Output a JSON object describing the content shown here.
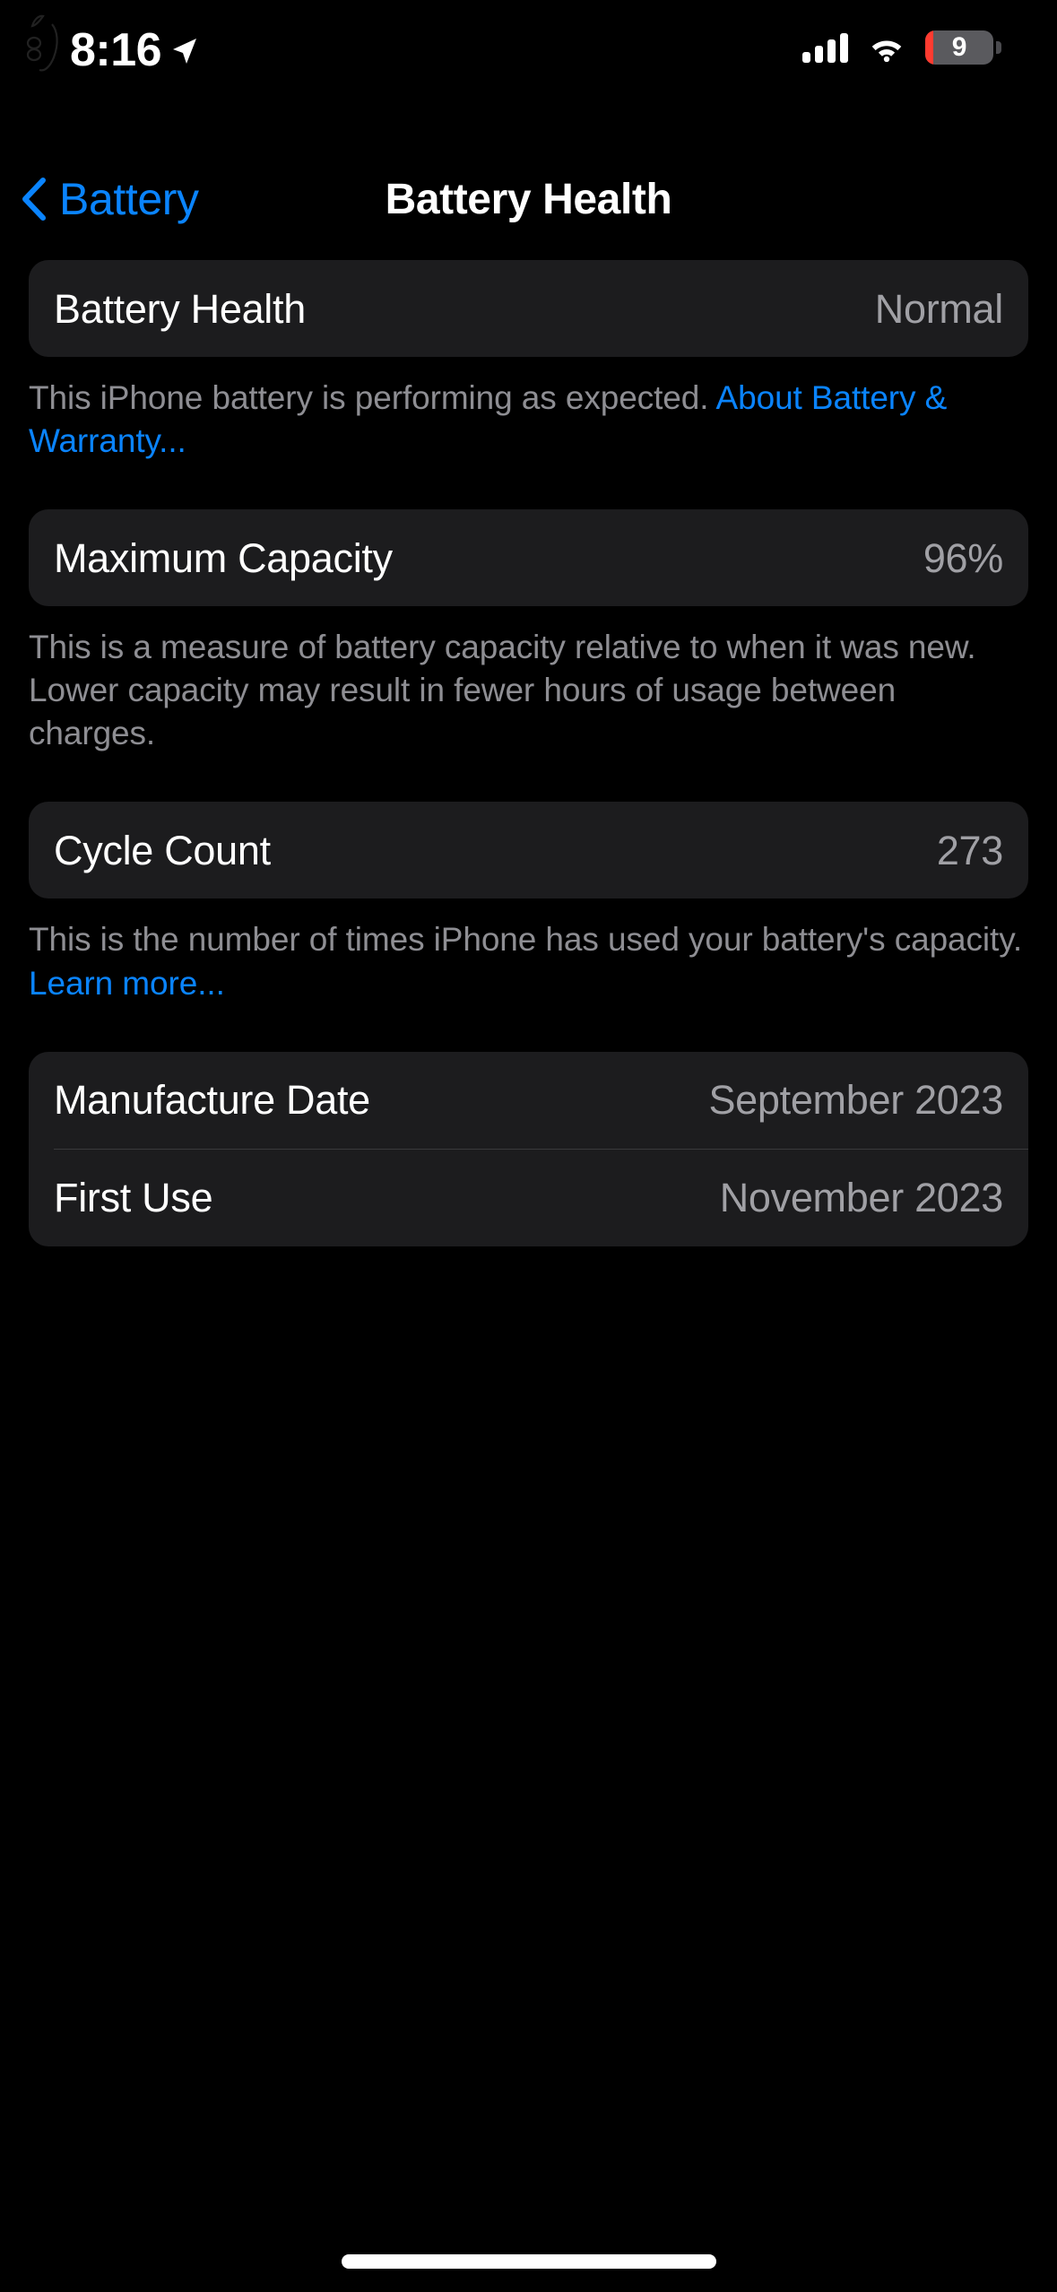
{
  "status_bar": {
    "time": "8:16",
    "location_icon": "location-arrow-icon",
    "cellular_icon": "cellular-signal-icon",
    "cellular_bars": 4,
    "wifi_icon": "wifi-icon",
    "battery_icon": "battery-icon",
    "battery_level": "9",
    "battery_low_color": "#ff3b30"
  },
  "watermark": {
    "icon": "apple-logo-icon"
  },
  "nav": {
    "back_icon": "chevron-left-icon",
    "back_label": "Battery",
    "title": "Battery Health",
    "accent_color": "#0a84ff"
  },
  "sections": {
    "battery_health": {
      "label": "Battery Health",
      "value": "Normal",
      "footnote_text": "This iPhone battery is performing as expected. ",
      "footnote_link": "About Battery & Warranty..."
    },
    "maximum_capacity": {
      "label": "Maximum Capacity",
      "value": "96%",
      "footnote_text": "This is a measure of battery capacity relative to when it was new. Lower capacity may result in fewer hours of usage between charges."
    },
    "cycle_count": {
      "label": "Cycle Count",
      "value": "273",
      "footnote_text": "This is the number of times iPhone has used your battery's capacity. ",
      "footnote_link": "Learn more..."
    },
    "dates": {
      "manufacture_label": "Manufacture Date",
      "manufacture_value": "September 2023",
      "first_use_label": "First Use",
      "first_use_value": "November 2023"
    }
  },
  "home_indicator": {
    "name": "home-indicator"
  }
}
